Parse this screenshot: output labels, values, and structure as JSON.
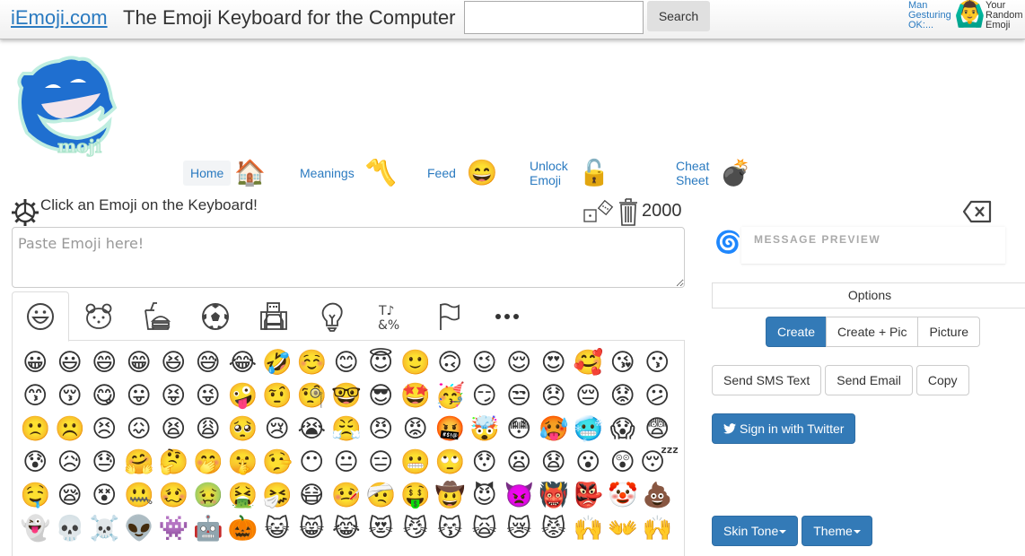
{
  "header": {
    "site_name": "iEmoji.com",
    "tagline": "The Emoji Keyboard for the Computer",
    "search_value": "",
    "search_button": "Search",
    "random_emoji_name": "Man Gesturing OK:...",
    "random_emoji_glyph": "🙆‍♂️",
    "random_emoji_caption": "Your Random Emoji"
  },
  "nav": {
    "items": [
      {
        "label": "Home",
        "emoji": "🏠",
        "active": true
      },
      {
        "label": "Meanings",
        "emoji": "〽️",
        "active": false
      },
      {
        "label": "Feed",
        "emoji": "😄",
        "active": false
      },
      {
        "label": "Unlock Emoji",
        "emoji": "🔓",
        "active": false
      },
      {
        "label": "Cheat Sheet",
        "emoji": "💣",
        "active": false
      }
    ]
  },
  "compose": {
    "prompt": "Click an Emoji on the Keyboard!",
    "placeholder": "Paste Emoji here!",
    "value": "",
    "char_count": "2000"
  },
  "categories": [
    {
      "name": "smileys",
      "active": true
    },
    {
      "name": "animals",
      "active": false
    },
    {
      "name": "food",
      "active": false
    },
    {
      "name": "activity",
      "active": false
    },
    {
      "name": "travel",
      "active": false
    },
    {
      "name": "objects",
      "active": false
    },
    {
      "name": "symbols",
      "active": false
    },
    {
      "name": "flags",
      "active": false
    },
    {
      "name": "more",
      "active": false
    }
  ],
  "emoji_grid": [
    [
      "😀",
      "😃",
      "😄",
      "😁",
      "😆",
      "😅",
      "😂",
      "🤣",
      "☺️",
      "😊",
      "😇",
      "🙂",
      "🙃",
      "😉",
      "😌",
      "😍",
      "🥰",
      "😘",
      "😗"
    ],
    [
      "😙",
      "😚",
      "😋",
      "😛",
      "😝",
      "😜",
      "🤪",
      "🤨",
      "🧐",
      "🤓",
      "😎",
      "🤩",
      "🥳",
      "😏",
      "😒",
      "😞",
      "😔",
      "😟",
      "😕"
    ],
    [
      "🙁",
      "☹️",
      "😣",
      "😖",
      "😫",
      "😩",
      "🥺",
      "😢",
      "😭",
      "😤",
      "😠",
      "😡",
      "🤬",
      "🤯",
      "😳",
      "🥵",
      "🥶",
      "😱",
      "😨"
    ],
    [
      "😰",
      "😥",
      "😓",
      "🤗",
      "🤔",
      "🤭",
      "🤫",
      "🤥",
      "😶",
      "😐",
      "😑",
      "😬",
      "🙄",
      "😯",
      "😦",
      "😧",
      "😮",
      "😲",
      "😴"
    ],
    [
      "🤤",
      "😪",
      "😵",
      "🤐",
      "🥴",
      "🤢",
      "🤮",
      "🤧",
      "😷",
      "🤒",
      "🤕",
      "🤑",
      "🤠",
      "😈",
      "👿",
      "👹",
      "👺",
      "🤡",
      "💩"
    ],
    [
      "👻",
      "💀",
      "☠️",
      "👽",
      "👾",
      "🤖",
      "🎃",
      "😺",
      "😸",
      "😹",
      "😻",
      "😼",
      "😽",
      "🙀",
      "😿",
      "😾",
      "🙌",
      "👐",
      "🙌"
    ]
  ],
  "preview": {
    "label": "MESSAGE PREVIEW"
  },
  "options": {
    "title": "Options",
    "mode_buttons": [
      {
        "label": "Create",
        "active": true
      },
      {
        "label": "Create + Pic",
        "active": false
      },
      {
        "label": "Picture",
        "active": false
      }
    ],
    "send_buttons": [
      "Send SMS Text",
      "Send Email",
      "Copy"
    ],
    "twitter_button": "Sign in with Twitter",
    "skin_tone_button": "Skin Tone",
    "theme_button": "Theme"
  },
  "colors": {
    "link": "#2a7ac0",
    "primary": "#337ab7"
  }
}
